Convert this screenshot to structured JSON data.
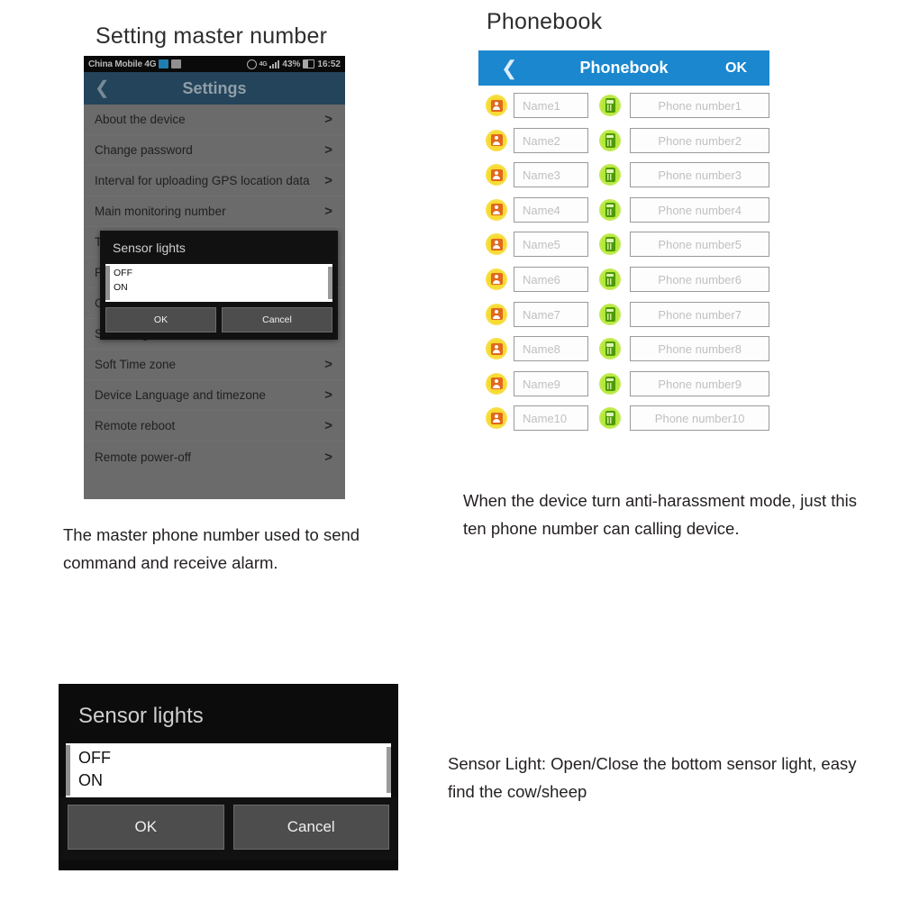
{
  "sections": {
    "master_title": "Setting master number",
    "phonebook_title": "Phonebook"
  },
  "captions": {
    "master": "The master phone number used to send command and receive alarm.",
    "phonebook": "When the device turn anti-harassment mode, just this ten phone number can calling device.",
    "sensor": "Sensor Light: Open/Close the bottom sensor light, easy find the cow/sheep"
  },
  "phone": {
    "statusbar": {
      "carrier": "China Mobile 4G",
      "network": "4G",
      "battery_percent": "43%",
      "time": "16:52"
    },
    "appbar": {
      "back_icon": "chevron-left-icon",
      "title": "Settings"
    },
    "settings_items": [
      {
        "label": "About the device",
        "chevron": ">"
      },
      {
        "label": "Change password",
        "chevron": ">"
      },
      {
        "label": "Interval for uploading GPS location data",
        "chevron": ">"
      },
      {
        "label": "Main monitoring number",
        "chevron": ">"
      },
      {
        "label": "T",
        "chevron": ">"
      },
      {
        "label": "P",
        "chevron": ">"
      },
      {
        "label": "C",
        "chevron": ">"
      },
      {
        "label": "Sensor lights",
        "chevron": ">"
      },
      {
        "label": "Soft Time zone",
        "chevron": ">"
      },
      {
        "label": "Device Language and timezone",
        "chevron": ">"
      },
      {
        "label": "Remote reboot",
        "chevron": ">"
      },
      {
        "label": "Remote power-off",
        "chevron": ">"
      }
    ]
  },
  "sensor_dialog": {
    "title": "Sensor lights",
    "options": [
      "OFF",
      "ON"
    ],
    "ok_label": "OK",
    "cancel_label": "Cancel"
  },
  "phonebook": {
    "bar": {
      "back_icon": "chevron-left-icon",
      "title": "Phonebook",
      "ok_label": "OK"
    },
    "rows": [
      {
        "name_placeholder": "Name1",
        "number_placeholder": "Phone number1"
      },
      {
        "name_placeholder": "Name2",
        "number_placeholder": "Phone number2"
      },
      {
        "name_placeholder": "Name3",
        "number_placeholder": "Phone number3"
      },
      {
        "name_placeholder": "Name4",
        "number_placeholder": "Phone number4"
      },
      {
        "name_placeholder": "Name5",
        "number_placeholder": "Phone number5"
      },
      {
        "name_placeholder": "Name6",
        "number_placeholder": "Phone number6"
      },
      {
        "name_placeholder": "Name7",
        "number_placeholder": "Phone number7"
      },
      {
        "name_placeholder": "Name8",
        "number_placeholder": "Phone number8"
      },
      {
        "name_placeholder": "Name9",
        "number_placeholder": "Phone number9"
      },
      {
        "name_placeholder": "Name10",
        "number_placeholder": "Phone number10"
      }
    ]
  },
  "colors": {
    "phonebook_blue": "#1a87cf",
    "settings_blue": "#2e5874",
    "dialog_black": "#0c0c0c",
    "person_icon_yellow": "#f5d000",
    "phone_icon_green": "#a7e020"
  }
}
